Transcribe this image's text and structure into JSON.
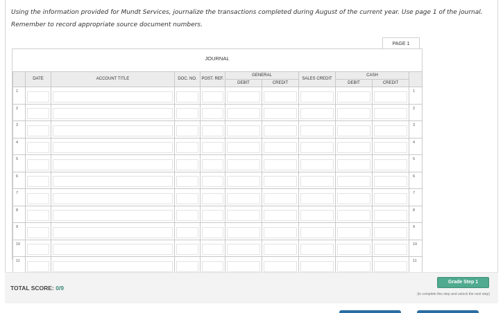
{
  "instructions": {
    "line1": "Using the information provided for Mundt Services, journalize the transactions completed during August of the current year. Use page 1 of the journal.",
    "line2": "Remember to record appropriate source document numbers."
  },
  "page_tab": "PAGE 1",
  "journal": {
    "title": "JOURNAL",
    "headers": {
      "date": "DATE",
      "account_title": "ACCOUNT TITLE",
      "doc_no": "DOC. NO.",
      "post_ref": "POST. REF.",
      "general": "GENERAL",
      "general_debit": "DEBIT",
      "general_credit": "CREDIT",
      "sales_credit": "SALES CREDIT",
      "cash": "CASH",
      "cash_debit": "DEBIT",
      "cash_credit": "CREDIT"
    },
    "row_numbers": [
      "1",
      "2",
      "3",
      "4",
      "5",
      "6",
      "7",
      "8",
      "9",
      "10",
      "11",
      "12"
    ]
  },
  "footer": {
    "total_score_label": "TOTAL SCORE:",
    "total_score_value": "0/9",
    "grade_button": "Grade Step 1",
    "grade_note": "(to complete this step and unlock the next step)"
  },
  "colors": {
    "accent": "#4faa8e",
    "score": "#3d8a78",
    "nav": "#2b6ea3"
  }
}
